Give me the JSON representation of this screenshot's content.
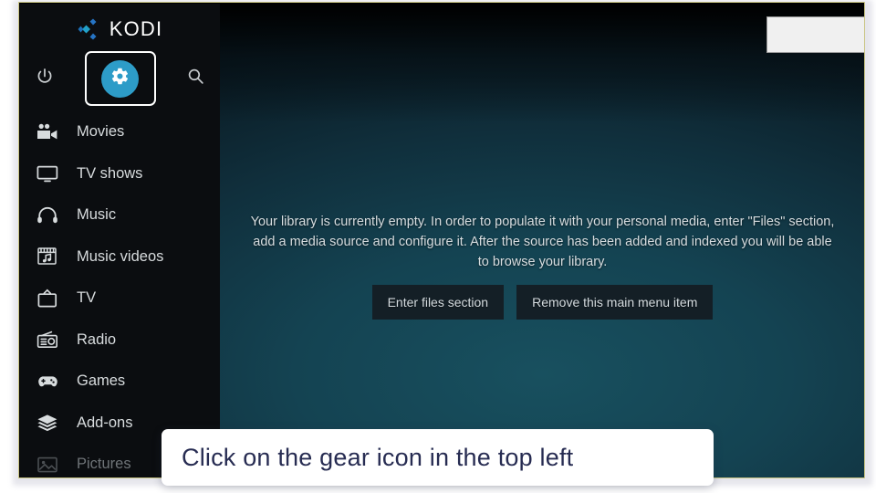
{
  "app": {
    "brand": "KODI",
    "logo_icon": "kodi-diamond-logo",
    "accent_color": "#2d9cc8",
    "sidebar_bg": "#0b0d10",
    "content_bg": "#144352"
  },
  "topbar": {
    "power": {
      "icon": "power-icon",
      "label": "Power"
    },
    "settings": {
      "icon": "gear-icon",
      "label": "Settings",
      "focused": true
    },
    "search": {
      "icon": "search-icon",
      "label": "Search"
    }
  },
  "sidebar": {
    "items": [
      {
        "label": "Movies",
        "icon": "movie-camera-icon",
        "dim": false
      },
      {
        "label": "TV shows",
        "icon": "tv-monitor-icon",
        "dim": false
      },
      {
        "label": "Music",
        "icon": "headphones-icon",
        "dim": false
      },
      {
        "label": "Music videos",
        "icon": "music-video-icon",
        "dim": false
      },
      {
        "label": "TV",
        "icon": "tv-antenna-icon",
        "dim": false
      },
      {
        "label": "Radio",
        "icon": "radio-icon",
        "dim": false
      },
      {
        "label": "Games",
        "icon": "gamepad-icon",
        "dim": false
      },
      {
        "label": "Add-ons",
        "icon": "layers-icon",
        "dim": false
      },
      {
        "label": "Pictures",
        "icon": "picture-icon",
        "dim": true
      }
    ]
  },
  "main": {
    "empty_message": "Your library is currently empty. In order to populate it with your personal media, enter \"Files\" section, add a media source and configure it. After the source has been added and indexed you will be able to browse your library.",
    "buttons": {
      "enter_files": "Enter files section",
      "remove_item": "Remove this main menu item"
    }
  },
  "overlay": {
    "top_right_box": ""
  },
  "caption": {
    "text": "Click on the gear icon in the top left"
  }
}
